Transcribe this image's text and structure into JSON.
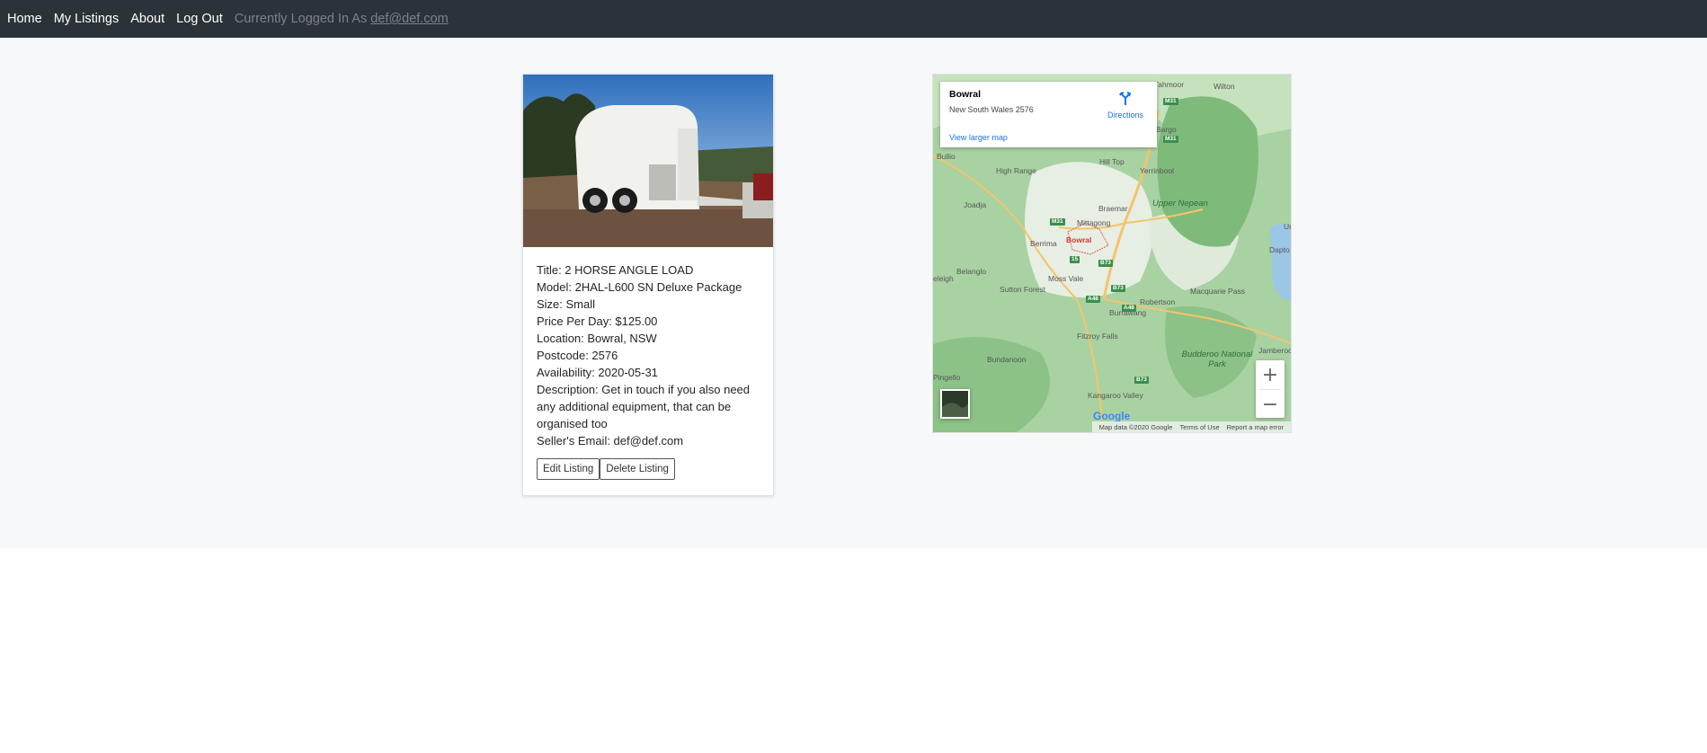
{
  "nav": {
    "links": [
      "Home",
      "My Listings",
      "About",
      "Log Out"
    ],
    "status_prefix": "Currently Logged In As",
    "status_email": "def@def.com"
  },
  "listing": {
    "photo_icon": "horse-trailer-photo",
    "details": [
      "Title: 2 HORSE ANGLE LOAD",
      "Model: 2HAL-L600 SN Deluxe Package",
      "Size: Small",
      "Price Per Day: $125.00",
      "Location: Bowral, NSW",
      "Postcode: 2576",
      "Availability: 2020-05-31",
      "Description: Get in touch if you also need any additional equipment, that can be organised too",
      "Seller's Email: def@def.com"
    ],
    "buttons": {
      "edit": "Edit Listing",
      "delete": "Delete Listing"
    }
  },
  "map": {
    "info": {
      "title": "Bowral",
      "subtitle": "New South Wales 2576",
      "directions": "Directions",
      "larger_map": "View larger map"
    },
    "zoom_in": "+",
    "zoom_out": "−",
    "logo": "Google",
    "footer": [
      "Map data ©2020 Google",
      "Terms of Use",
      "Report a map error"
    ],
    "places": [
      "Tahmoor",
      "Wilton",
      "Bargo",
      "Bullio",
      "Hill Top",
      "Yerrinbool",
      "High Range",
      "Joadja",
      "Braemar",
      "Mittagong",
      "Berrima",
      "Bowral",
      "Moss Vale",
      "Belanglo",
      "Sutton Forest",
      "Robertson",
      "Burrawang",
      "Dapto",
      "Macquarie Pass",
      "Fitzroy Falls",
      "Bundanoon",
      "Kangaroo Valley",
      "Jamberoo",
      "Pingello",
      "Ur",
      "eleigh"
    ],
    "parks": [
      "Upper Nepean",
      "Budderoo National Park"
    ],
    "shields": [
      "M31",
      "M31",
      "M31",
      "15",
      "B73",
      "B73",
      "A48",
      "A48",
      "B73"
    ]
  }
}
